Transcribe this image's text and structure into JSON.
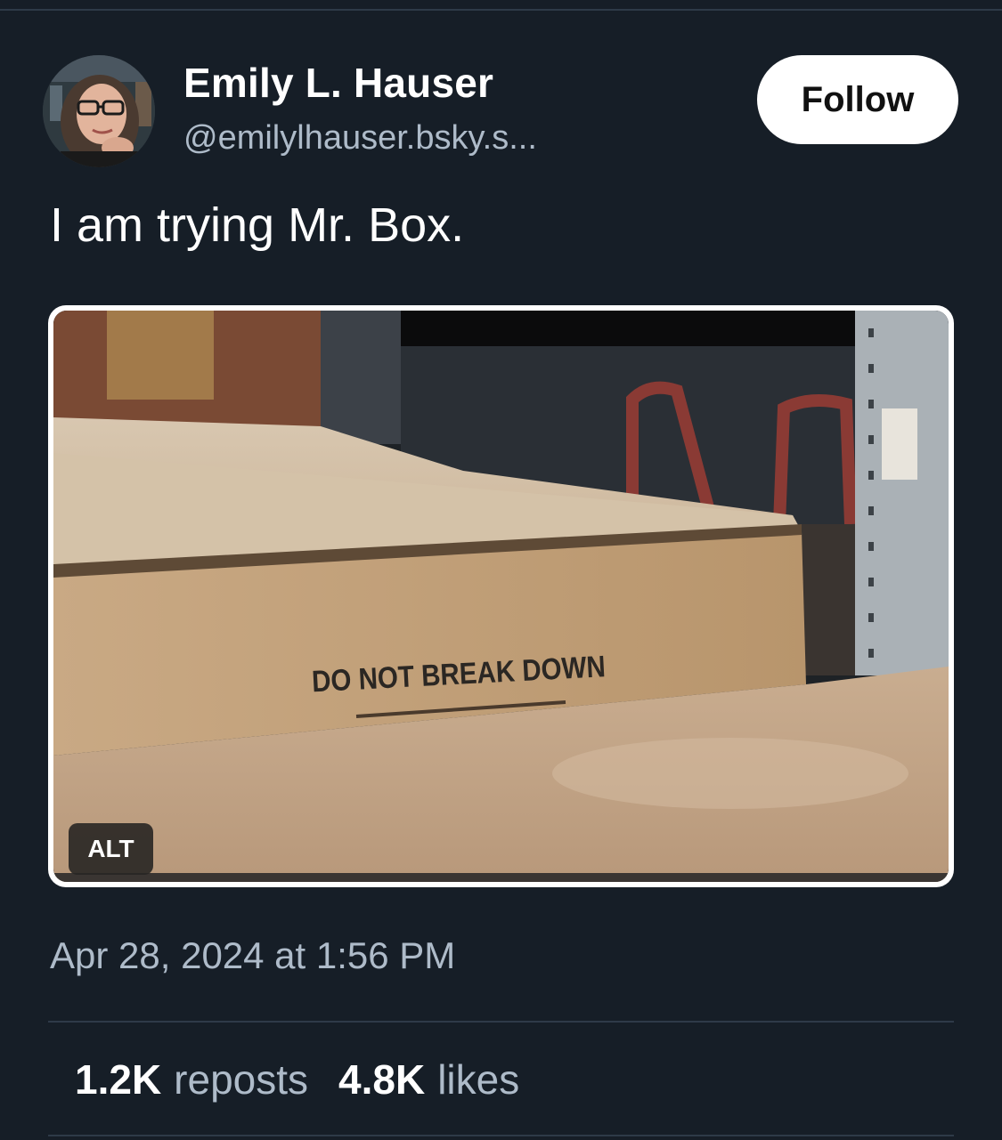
{
  "author": {
    "display_name": "Emily L. Hauser",
    "handle": "@emilylhauser.bsky.s..."
  },
  "follow_label": "Follow",
  "post": {
    "text": "I am trying Mr. Box.",
    "image": {
      "printed_text": "DO NOT BREAK DOWN",
      "alt_label": "ALT"
    },
    "timestamp": "Apr 28, 2024 at 1:56 PM"
  },
  "stats": {
    "reposts_count": "1.2K",
    "reposts_label": "reposts",
    "likes_count": "4.8K",
    "likes_label": "likes"
  },
  "colors": {
    "background": "#161e27",
    "secondary_text": "#aebbc9",
    "divider": "#2e3a48",
    "button_bg": "#ffffff"
  }
}
